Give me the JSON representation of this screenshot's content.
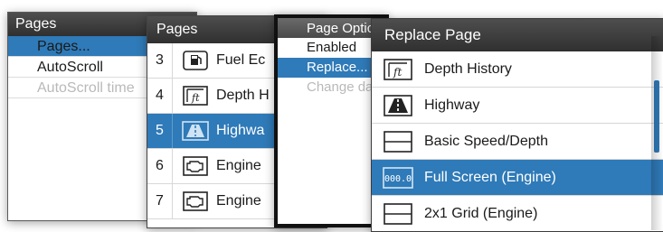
{
  "panel1": {
    "title": "Pages",
    "items": [
      {
        "label": "Pages...",
        "selected": true,
        "disabled": false
      },
      {
        "label": "AutoScroll",
        "selected": false,
        "disabled": false
      },
      {
        "label": "AutoScroll time",
        "selected": false,
        "disabled": true
      }
    ]
  },
  "panel2": {
    "title": "Pages",
    "rows": [
      {
        "num": "3",
        "label": "Fuel Ec",
        "icon": "fuel-icon",
        "selected": false
      },
      {
        "num": "4",
        "label": "Depth H",
        "icon": "depth-history-icon",
        "selected": false
      },
      {
        "num": "5",
        "label": "Highwa",
        "icon": "highway-icon",
        "selected": true
      },
      {
        "num": "6",
        "label": "Engine",
        "icon": "engine-icon",
        "selected": false
      },
      {
        "num": "7",
        "label": "Engine",
        "icon": "engine-icon",
        "selected": false
      }
    ]
  },
  "panel3": {
    "title": "Page Optic",
    "items": [
      {
        "label": "Enabled",
        "selected": false,
        "disabled": false
      },
      {
        "label": "Replace...",
        "selected": true,
        "disabled": false
      },
      {
        "label": "Change da",
        "selected": false,
        "disabled": true
      }
    ]
  },
  "panel4": {
    "title": "Replace Page",
    "rows": [
      {
        "label": "Depth History",
        "icon": "depth-history-icon",
        "selected": false
      },
      {
        "label": "Highway",
        "icon": "highway-icon",
        "selected": false
      },
      {
        "label": "Basic Speed/Depth",
        "icon": "split-horizontal-icon",
        "selected": false
      },
      {
        "label": "Full Screen (Engine)",
        "icon": "digital-display-icon",
        "icon_text": "000.0",
        "selected": true
      },
      {
        "label": "2x1 Grid (Engine)",
        "icon": "split-horizontal-icon",
        "selected": false
      }
    ]
  },
  "colors": {
    "selection": "#2f7ab8",
    "header": "#3a3a3a",
    "disabled_text": "#b9b9b9"
  }
}
